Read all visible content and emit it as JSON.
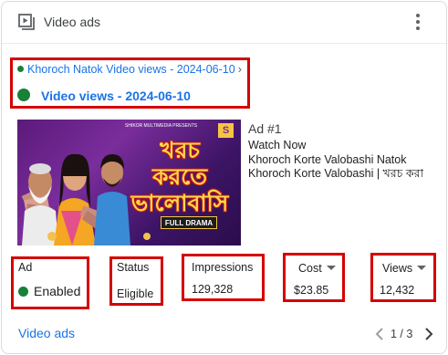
{
  "header": {
    "title": "Video ads",
    "icon": "video-play-icon",
    "menu_icon": "more-vert-icon"
  },
  "campaign": {
    "breadcrumb": "Khoroch Natok Video views - 2024-06-10",
    "breadcrumb_chevron": "›",
    "name": "Video views - 2024-06-10",
    "status_color": "#188038"
  },
  "thumbnail": {
    "top_text": "SHIKOR MULTIMEDIA PRESENTS",
    "title_art": "খরচ\nকরতে\nভালোবাসি",
    "badge": "FULL DRAMA",
    "logo": "S"
  },
  "ad": {
    "number": "Ad #1",
    "lines": [
      "Watch Now",
      "Khoroch Korte Valobashi Natok",
      "Khoroch Korte Valobashi | খরচ করা"
    ]
  },
  "metrics": {
    "ad": {
      "label": "Ad",
      "value": "Enabled",
      "status_color": "#188038"
    },
    "status": {
      "label": "Status",
      "value": "Eligible"
    },
    "impressions": {
      "label": "Impressions",
      "value": "129,328"
    },
    "cost": {
      "label": "Cost",
      "value": "$23.85"
    },
    "views": {
      "label": "Views",
      "value": "12,432"
    }
  },
  "footer": {
    "link": "Video ads",
    "page": "1 / 3"
  },
  "colors": {
    "accent": "#1a73e8",
    "highlight_border": "#d50000",
    "enabled_green": "#188038"
  }
}
